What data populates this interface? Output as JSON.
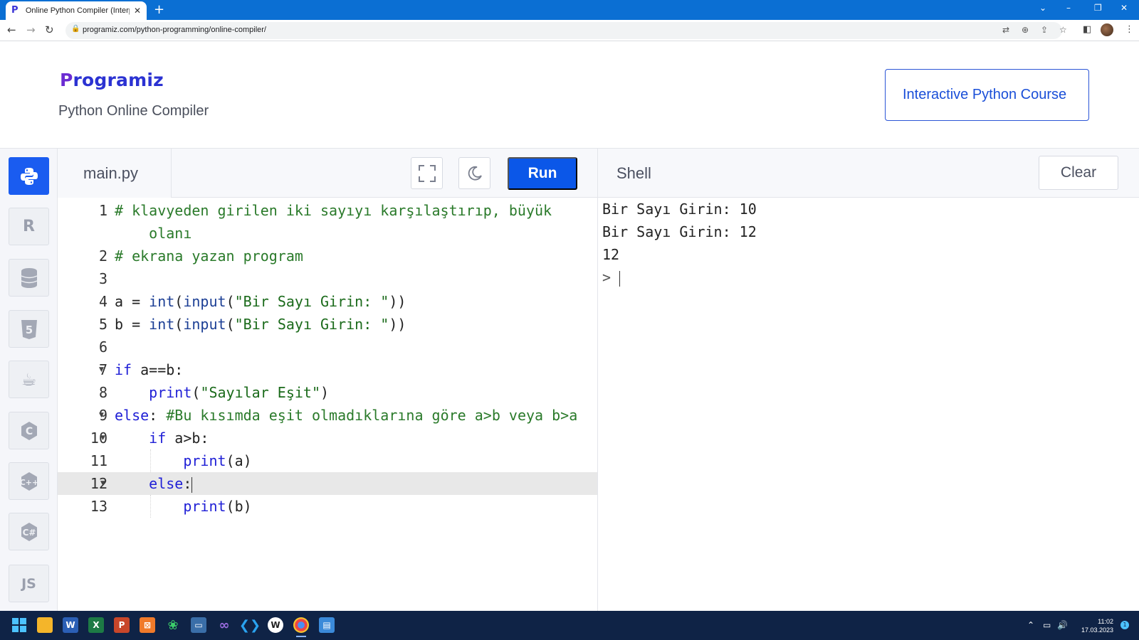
{
  "browser": {
    "tab_title": "Online Python Compiler (Interpreter)",
    "url": "programiz.com/python-programming/online-compiler/"
  },
  "header": {
    "logo_text": "rogramiz",
    "subtitle": "Python Online Compiler",
    "course_button": "Interactive Python Course"
  },
  "languages": [
    {
      "name": "Python",
      "glyph": "py"
    },
    {
      "name": "R",
      "glyph": "R"
    },
    {
      "name": "SQL",
      "glyph": "db"
    },
    {
      "name": "HTML",
      "glyph": "5"
    },
    {
      "name": "Java",
      "glyph": "java"
    },
    {
      "name": "C",
      "glyph": "C"
    },
    {
      "name": "C++",
      "glyph": "C++"
    },
    {
      "name": "C#",
      "glyph": "C#"
    },
    {
      "name": "JavaScript",
      "glyph": "JS"
    }
  ],
  "editor": {
    "filename": "main.py",
    "run_label": "Run",
    "active_line": 12,
    "lines": [
      {
        "num": "1",
        "text": "# klavyeden girilen iki sayıyı karşılaştırıp, büyük",
        "type": "comment"
      },
      {
        "num": "",
        "text": "    olanı",
        "type": "comment"
      },
      {
        "num": "2",
        "text": "# ekrana yazan program",
        "type": "comment"
      },
      {
        "num": "3",
        "text": "",
        "type": "plain"
      },
      {
        "num": "4",
        "text": "a = int(input(\"Bir Sayı Girin: \"))",
        "type": "assign"
      },
      {
        "num": "5",
        "text": "b = int(input(\"Bir Sayı Girin: \"))",
        "type": "assign"
      },
      {
        "num": "6",
        "text": "",
        "type": "plain"
      },
      {
        "num": "7",
        "text": "if a==b:",
        "type": "if"
      },
      {
        "num": "8",
        "text": "    print(\"Sayılar Eşit\")",
        "type": "print-str"
      },
      {
        "num": "9",
        "text": "else: #Bu kısımda eşit olmadıklarına göre a>b veya b>a",
        "type": "else-comment"
      },
      {
        "num": "10",
        "text": "    if a>b:",
        "type": "if"
      },
      {
        "num": "11",
        "text": "        print(a)",
        "type": "print"
      },
      {
        "num": "12",
        "text": "    else:",
        "type": "else"
      },
      {
        "num": "13",
        "text": "        print(b)",
        "type": "print"
      }
    ]
  },
  "shell": {
    "title": "Shell",
    "clear_label": "Clear",
    "output": [
      "Bir Sayı Girin: 10",
      "Bir Sayı Girin: 12",
      "12"
    ],
    "prompt": ">"
  },
  "taskbar": {
    "time": "11:02",
    "date": "17.03.2023"
  }
}
